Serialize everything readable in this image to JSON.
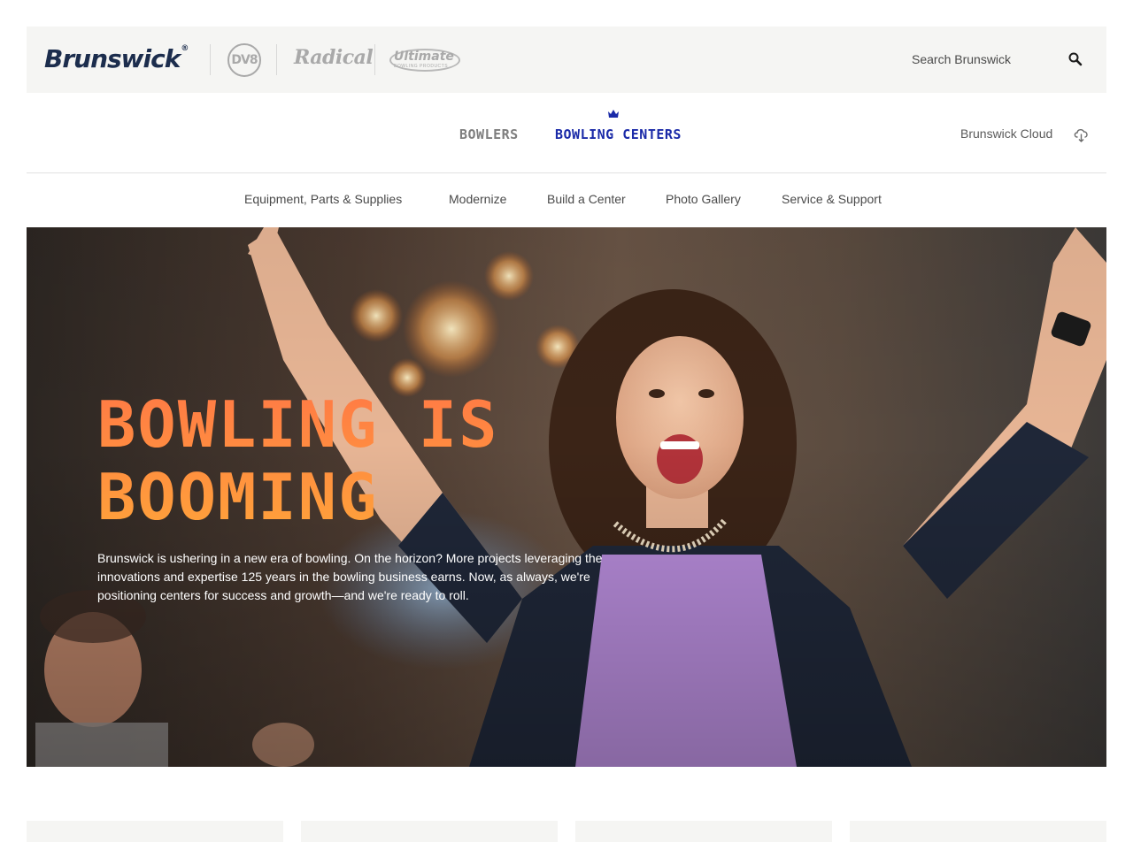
{
  "brands": {
    "primary": "Brunswick",
    "primary_mark": "®",
    "dv8": "DV8",
    "radical": "Radical",
    "ultimate": "Ultimate",
    "ultimate_sub": "BOWLING PRODUCTS"
  },
  "search": {
    "placeholder": "Search Brunswick",
    "icon": "search-icon"
  },
  "primary_nav": {
    "items": [
      {
        "label": "BOWLERS",
        "active": false
      },
      {
        "label": "BOWLING CENTERS",
        "active": true,
        "icon": "crown-icon"
      }
    ],
    "cloud_link": {
      "label": "Brunswick Cloud",
      "icon": "cloud-download-icon"
    }
  },
  "secondary_nav": {
    "items": [
      {
        "label": "Equipment, Parts & Supplies"
      },
      {
        "label": "Modernize"
      },
      {
        "label": "Build a Center"
      },
      {
        "label": "Photo Gallery"
      },
      {
        "label": "Service & Support"
      }
    ]
  },
  "hero": {
    "heading_line1": "BOWLING IS",
    "heading_line2": "BOOMING",
    "body": "Brunswick is ushering in a new era of bowling. On the horizon? More projects leveraging the innovations and expertise 125 years in the bowling business earns. Now, as always, we're positioning centers for success and growth—and we're ready to roll."
  },
  "colors": {
    "brand_navy": "#1c2d4d",
    "active_nav": "#1a2aa8",
    "inactive_nav": "#7e7e7e",
    "heading_orange": "#ff8a3d",
    "bar_bg": "#f5f5f3"
  }
}
